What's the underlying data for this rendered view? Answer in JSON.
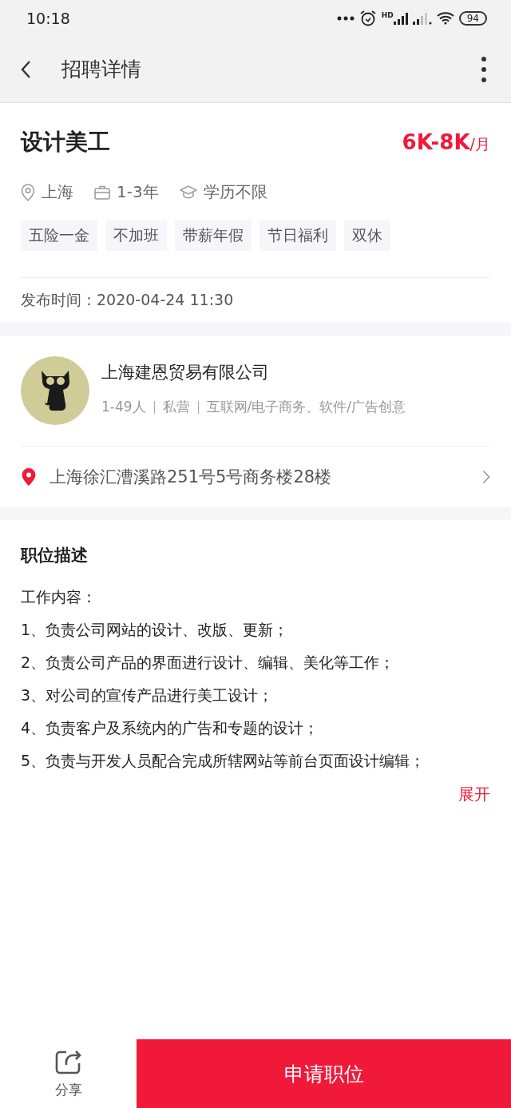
{
  "status_bar": {
    "time": "10:18",
    "network_label": "HD",
    "battery": "94"
  },
  "header": {
    "title": "招聘详情"
  },
  "job": {
    "title": "设计美工",
    "salary": "6K-8K",
    "salary_unit": "/月",
    "meta": [
      {
        "kind": "location",
        "text": "上海"
      },
      {
        "kind": "experience",
        "text": "1-3年"
      },
      {
        "kind": "education",
        "text": "学历不限"
      }
    ],
    "tags": [
      "五险一金",
      "不加班",
      "带薪年假",
      "节日福利",
      "双休"
    ],
    "published": "发布时间：2020-04-24  11:30"
  },
  "company": {
    "name": "上海建恩贸易有限公司",
    "size": "1-49人",
    "type": "私营",
    "industry": "互联网/电子商务、软件/广告创意",
    "address": "上海徐汇漕溪路251号5号商务楼28楼"
  },
  "description": {
    "heading": "职位描述",
    "lines": [
      "工作内容：",
      "1、负责公司网站的设计、改版、更新；",
      "2、负责公司产品的界面进行设计、编辑、美化等工作；",
      "3、对公司的宣传产品进行美工设计；",
      "4、负责客户及系统内的广告和专题的设计；",
      "5、负责与开发人员配合完成所辖网站等前台页面设计编辑；"
    ],
    "expand": "展开"
  },
  "bottom_bar": {
    "share": "分享",
    "apply": "申请职位"
  }
}
